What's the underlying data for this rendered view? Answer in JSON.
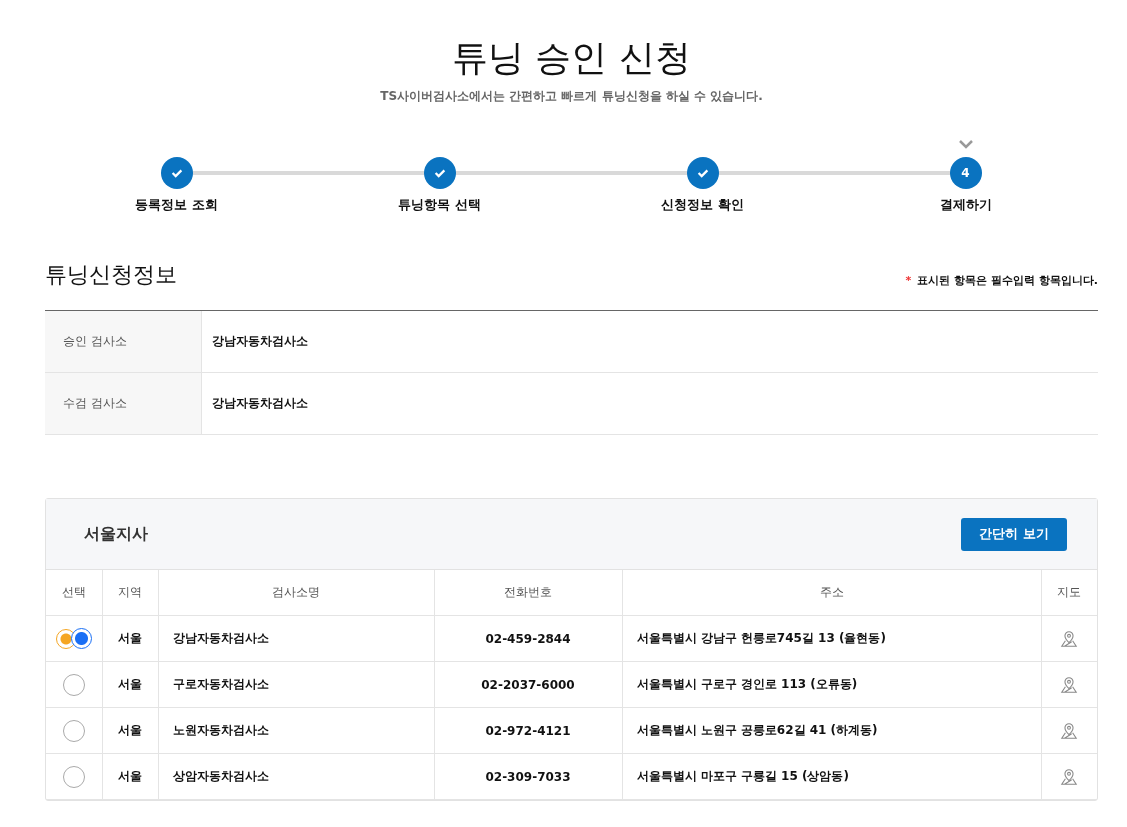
{
  "title": "튜닝 승인 신청",
  "subtitle": "TS사이버검사소에서는 간편하고 빠르게 튜닝신청을 하실 수 있습니다.",
  "steps": [
    {
      "label": "등록정보 조회",
      "done": true,
      "current": false
    },
    {
      "label": "튜닝항목 선택",
      "done": true,
      "current": false
    },
    {
      "label": "신청정보 확인",
      "done": true,
      "current": false
    },
    {
      "label": "결제하기",
      "number": "4",
      "done": false,
      "current": true
    }
  ],
  "info": {
    "heading": "튜닝신청정보",
    "required_mark": "*",
    "required_note": "표시된 항목은 필수입력 항목입니다.",
    "rows": [
      {
        "label": "승인 검사소",
        "value": "강남자동차검사소"
      },
      {
        "label": "수검 검사소",
        "value": "강남자동차검사소"
      }
    ]
  },
  "branch": {
    "title": "서울지사",
    "button": "간단히 보기",
    "columns": [
      "선택",
      "지역",
      "검사소명",
      "전화번호",
      "주소",
      "지도"
    ],
    "rows": [
      {
        "selected": true,
        "region": "서울",
        "name": "강남자동차검사소",
        "phone": "02-459-2844",
        "address": "서울특별시 강남구 헌릉로745길 13 (율현동)"
      },
      {
        "selected": false,
        "region": "서울",
        "name": "구로자동차검사소",
        "phone": "02-2037-6000",
        "address": "서울특별시 구로구 경인로 113 (오류동)"
      },
      {
        "selected": false,
        "region": "서울",
        "name": "노원자동차검사소",
        "phone": "02-972-4121",
        "address": "서울특별시 노원구 공릉로62길 41 (하계동)"
      },
      {
        "selected": false,
        "region": "서울",
        "name": "상암자동차검사소",
        "phone": "02-309-7033",
        "address": "서울특별시 마포구 구룡길 15 (상암동)"
      }
    ]
  }
}
